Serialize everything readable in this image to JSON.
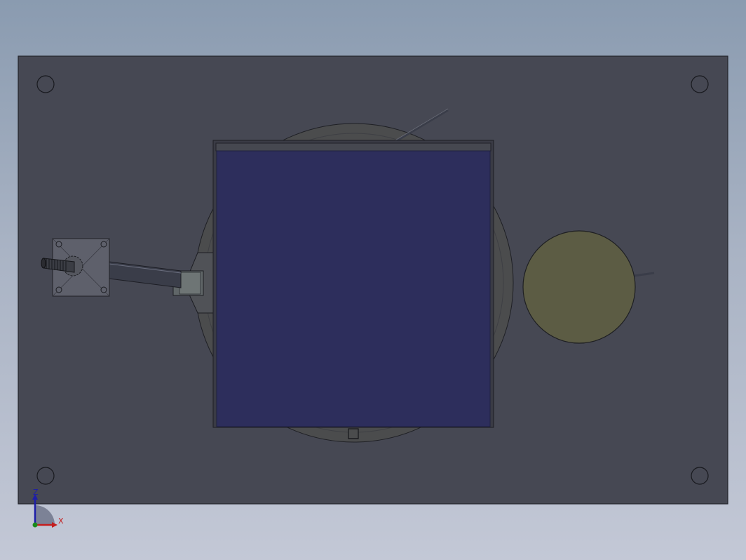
{
  "viewport": {
    "colors": {
      "plate": "#464853",
      "plate_edge": "#22232a",
      "turntable": "#4b4c4d",
      "enclosure": "#2d2e5c",
      "enclosure_frame": "#3a3b45",
      "disc": "#5c5c44",
      "rod": "#3a3d49",
      "bracket": "#505257"
    }
  },
  "triad": {
    "z_label": "Z",
    "x_label": "X",
    "colors": {
      "z_axis": "#1e1ea8",
      "x_axis": "#c41e1e",
      "plane": "#7c8296",
      "origin": "#1a8a1a"
    }
  }
}
